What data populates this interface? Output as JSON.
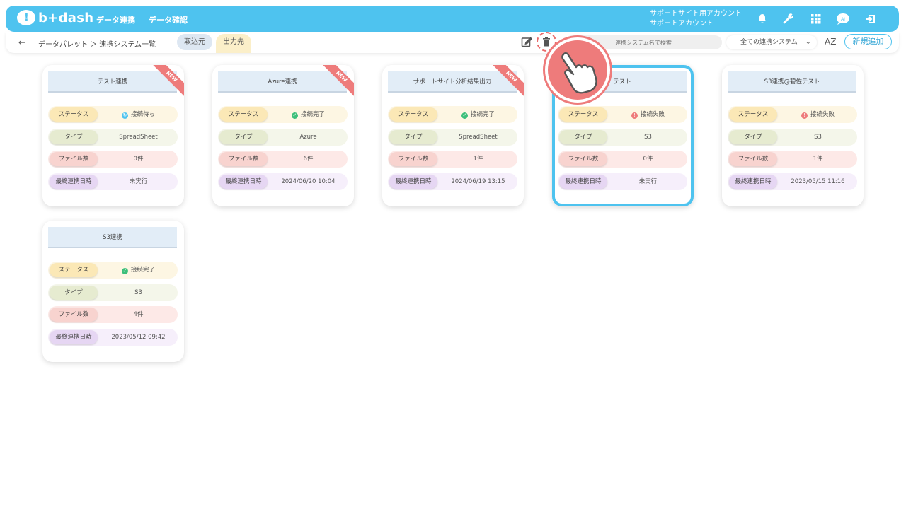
{
  "header": {
    "logo_text": "b+dash",
    "nav": [
      "データ連携",
      "データ確認"
    ],
    "account_line1": "サポートサイト用アカウント",
    "account_line2": "サポートアカウント"
  },
  "toolbar": {
    "back_symbol": "←",
    "breadcrumb": "データパレット ＞ 連携システム一覧",
    "tab_import": "取込元",
    "tab_export": "出力先",
    "search_placeholder": "連携システム名で検索",
    "filter_value": "全ての連携システム",
    "sort_label": "AZ",
    "add_label": "新規追加"
  },
  "labels": {
    "status": "ステータス",
    "type": "タイプ",
    "files": "ファイル数",
    "last": "最終連携日時"
  },
  "new_badge": "NEW",
  "cards": [
    {
      "title": "テスト連携",
      "status": "接続待ち",
      "status_kind": "wait",
      "type": "SpreadSheet",
      "files": "0件",
      "last": "未実行",
      "is_new": true
    },
    {
      "title": "Azure連携",
      "status": "接続完了",
      "status_kind": "ok",
      "type": "Azure",
      "files": "6件",
      "last": "2024/06/20 10:04",
      "is_new": true
    },
    {
      "title": "サポートサイト分析結果出力",
      "status": "接続完了",
      "status_kind": "ok",
      "type": "SpreadSheet",
      "files": "1件",
      "last": "2024/06/19 13:15",
      "is_new": true
    },
    {
      "title": "テスト",
      "status": "接続失敗",
      "status_kind": "err",
      "type": "S3",
      "files": "0件",
      "last": "未実行",
      "is_new": false,
      "selected": true
    },
    {
      "title": "S3連携@碧佐テスト",
      "status": "接続失敗",
      "status_kind": "err",
      "type": "S3",
      "files": "1件",
      "last": "2023/05/15 11:16",
      "is_new": false
    },
    {
      "title": "S3連携",
      "status": "接続完了",
      "status_kind": "ok",
      "type": "S3",
      "files": "4件",
      "last": "2023/05/12 09:42",
      "is_new": false
    }
  ],
  "colors": {
    "accent": "#4ec3ef",
    "highlight": "#ee7b7b"
  }
}
